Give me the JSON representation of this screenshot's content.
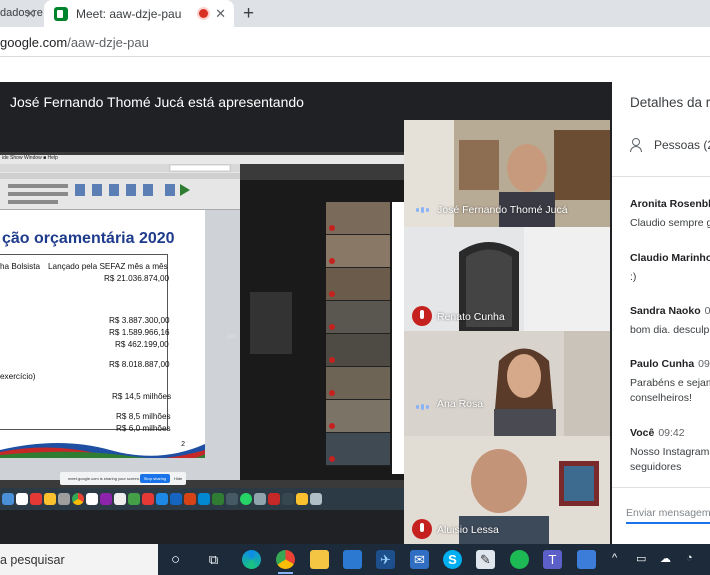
{
  "browser": {
    "tabs": [
      {
        "title": "dados re",
        "close": "✕"
      },
      {
        "title": "Meet: aaw-dzje-pau",
        "close": "✕"
      }
    ],
    "new_tab": "+",
    "url_host": "google.com",
    "url_path": "/aaw-dzje-pau"
  },
  "meet": {
    "presenting_banner": "José Fernando Thomé Jucá está apresentando",
    "participants": [
      {
        "name": "José Fernando Thomé Jucá",
        "state": "speaking"
      },
      {
        "name": "Renato Cunha",
        "state": "muted"
      },
      {
        "name": "Ana Rosa",
        "state": "speaking"
      },
      {
        "name": "Aluisio Lessa",
        "state": "muted"
      }
    ]
  },
  "slide": {
    "title": "ção orçamentária 2020",
    "col1_header": "ha Bolsista",
    "col2_header": "Lançado pela SEFAZ mês a mês",
    "values": [
      "R$ 21.036.874,00",
      "R$ 3.887.300,00",
      "R$ 1.589.966,16",
      "R$ 462.199,00",
      "R$ 8.018.887,00",
      "R$ 14,5 milhões",
      "R$ 8,5 milhões",
      "R$ 6,0 milhões"
    ],
    "exercicio": "exercício)",
    "page_number": "2",
    "share_bar_text": "meet.google.com is sharing your screen.",
    "share_bar_stop": "Stop sharing",
    "share_bar_hide": "Hide",
    "gray_text": "dos"
  },
  "panel": {
    "title": "Detalhes da re",
    "people_label": "Pessoas (2",
    "messages": [
      {
        "who": "Aronita Rosenbla",
        "time": "",
        "lines": [
          "Claudio sempre g"
        ]
      },
      {
        "who": "Claudio Marinho",
        "time": "",
        "lines": [
          ":)"
        ]
      },
      {
        "who": "Sandra Naoko",
        "time": "09",
        "lines": [
          "bom dia. desculp"
        ]
      },
      {
        "who": "Paulo Cunha",
        "time": "09:3",
        "lines": [
          "Parabéns e sejam",
          "conselheiros!"
        ]
      },
      {
        "who": "Você",
        "time": "09:42",
        "lines": [
          "Nosso Instagram",
          "seguidores"
        ]
      }
    ],
    "input_placeholder": "Enviar mensagem"
  },
  "taskbar": {
    "search_text": "a pesquisar"
  },
  "colors": {
    "meet_bg": "#202124",
    "muted_red": "#c5221f",
    "slide_title_blue": "#1f3c8c",
    "taskbar": "#1c2a3a"
  }
}
